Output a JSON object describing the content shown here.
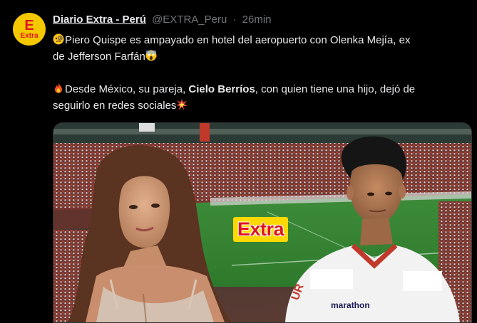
{
  "tweet": {
    "author_name": "Diario Extra - Perú",
    "handle": "@EXTRA_Peru",
    "separator": "·",
    "time": "26min",
    "avatar": {
      "big_letter": "E",
      "small_text": "Extra",
      "bg_color": "#f5c800",
      "fg_color": "#e0141b"
    },
    "line1": "Piero Quispe es ampayado en hotel del aeropuerto con Olenka Mejía, ex",
    "line2": "de Jefferson Farfán",
    "line3_before": "Desde México, su pareja, ",
    "line3_bold": "Cielo Berríos",
    "line3_after": ", con quien tiene una hijo, dejó de",
    "line4": "seguirlo en redes sociales",
    "emojis": [
      "monocle-face-icon",
      "screaming-face-icon",
      "fire-icon",
      "collision-icon"
    ]
  },
  "media": {
    "brand_label": "Extra",
    "jersey_text": "marathon"
  }
}
